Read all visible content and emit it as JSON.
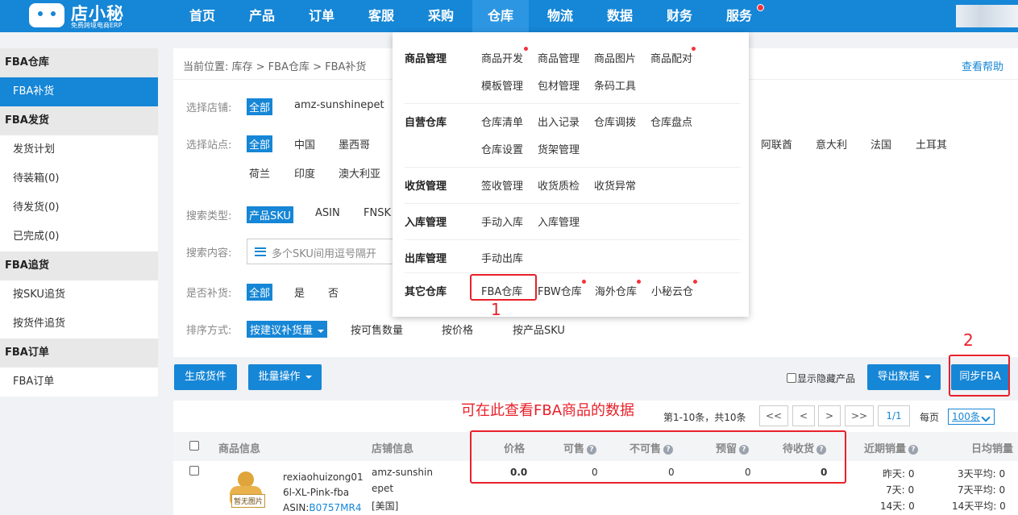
{
  "brand": {
    "name": "店小秘",
    "tagline": "免费跨境电商ERP"
  },
  "nav": [
    "首页",
    "产品",
    "订单",
    "客服",
    "采购",
    "仓库",
    "物流",
    "数据",
    "财务",
    "服务"
  ],
  "sidebar": {
    "groups": [
      {
        "title": "FBA仓库",
        "items": [
          "FBA补货"
        ]
      },
      {
        "title": "FBA发货",
        "items": [
          "发货计划",
          "待装箱(0)",
          "待发货(0)",
          "已完成(0)"
        ]
      },
      {
        "title": "FBA追货",
        "items": [
          "按SKU追货",
          "按货件追货"
        ]
      },
      {
        "title": "FBA订单",
        "items": [
          "FBA订单"
        ]
      }
    ]
  },
  "breadcrumb": "当前位置:  库存 > FBA仓库 > FBA补货",
  "help": "查看帮助",
  "filters": {
    "shop_label": "选择店铺:",
    "shop_all": "全部",
    "shop_name": "amz-sunshinepet",
    "site_label": "选择站点:",
    "site_all": "全部",
    "sites_row1": [
      "中国",
      "墨西哥"
    ],
    "sites_row1_right": [
      "阿联酋",
      "意大利",
      "法国",
      "土耳其"
    ],
    "sites_row2": [
      "荷兰",
      "印度",
      "澳大利亚"
    ],
    "search_type_label": "搜索类型:",
    "search_types": [
      "产品SKU",
      "ASIN",
      "FNSK"
    ],
    "search_content_label": "搜索内容:",
    "search_placeholder": "多个SKU间用逗号隔开",
    "replenish_label": "是否补货:",
    "replenish_opts": [
      "全部",
      "是",
      "否"
    ],
    "sort_label": "排序方式:",
    "sort_selected": "按建议补货量",
    "sort_opts": [
      "按可售数量",
      "按价格",
      "按产品SKU"
    ]
  },
  "actions": {
    "generate": "生成货件",
    "batch": "批量操作",
    "show_hidden": "显示隐藏产品",
    "export": "导出数据",
    "sync": "同步FBA"
  },
  "pager": {
    "info": "第1-10条，共10条",
    "buttons": [
      "<<",
      "<",
      ">",
      ">>"
    ],
    "page": "1/1",
    "per_label": "每页",
    "per_value": "100条"
  },
  "table": {
    "headers": [
      "商品信息",
      "店铺信息",
      "价格",
      "可售",
      "不可售",
      "预留",
      "待收货",
      "近期销量",
      "日均销量"
    ],
    "row": {
      "sku_line1": "rexiaohuizong01",
      "sku_line2": "6l-XL-Pink-fba",
      "asin_label": "ASIN:",
      "asin": "B0757MR4",
      "img_tag": "暂无图片",
      "shop_line1": "amz-sunshin",
      "shop_line2": "epet",
      "shop_line3": "[美国]",
      "price": "0.0",
      "available": "0",
      "unavailable": "0",
      "reserved": "0",
      "inbound": "0",
      "recent": [
        "昨天:  0",
        "7天:  0",
        "14天:  0"
      ],
      "daily": [
        "3天平均:  0",
        "7天平均:  0",
        "14天平均:  0"
      ]
    }
  },
  "dropdown": {
    "sections": [
      {
        "title": "商品管理",
        "items": [
          "商品开发",
          "商品管理",
          "商品图片",
          "商品配对",
          "模板管理",
          "包材管理",
          "条码工具"
        ]
      },
      {
        "title": "自营仓库",
        "items": [
          "仓库清单",
          "出入记录",
          "仓库调拨",
          "仓库盘点",
          "仓库设置",
          "货架管理"
        ]
      },
      {
        "title": "收货管理",
        "items": [
          "签收管理",
          "收货质检",
          "收货异常"
        ]
      },
      {
        "title": "入库管理",
        "items": [
          "手动入库",
          "入库管理"
        ]
      },
      {
        "title": "出库管理",
        "items": [
          "手动出库"
        ]
      },
      {
        "title": "其它仓库",
        "items": [
          "FBA仓库",
          "FBW仓库",
          "海外仓库",
          "小秘云仓"
        ]
      }
    ]
  },
  "annotations": {
    "one": "1",
    "two": "2",
    "note": "可在此查看FBA商品的数据"
  },
  "colors": {
    "primary": "#1686d6",
    "annotation": "#e8202a"
  }
}
